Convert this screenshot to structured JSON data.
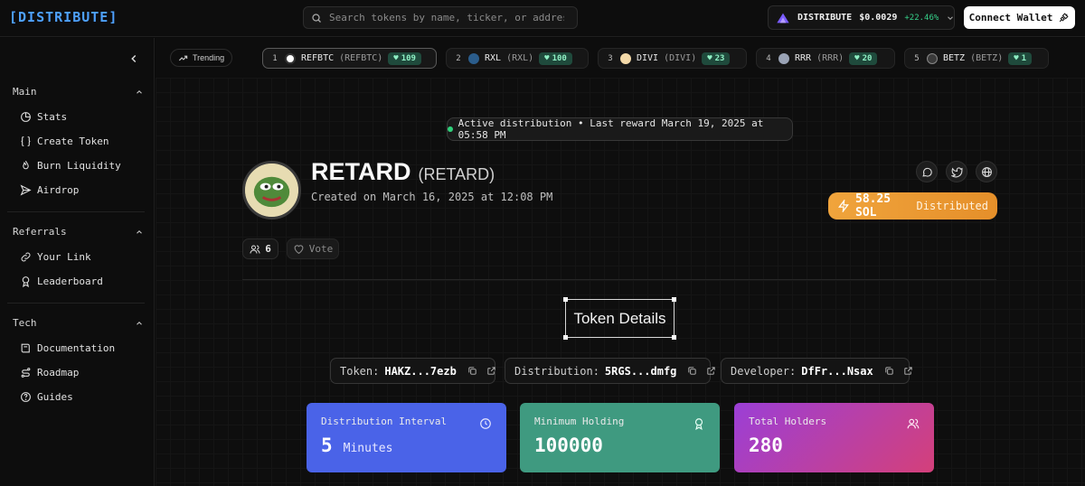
{
  "header": {
    "logo": "[DISTRIBUTE]",
    "search_placeholder": "Search tokens by name, ticker, or address...",
    "price_token": "DISTRIBUTE",
    "price_value": "$0.0029",
    "price_change": "+22.46%",
    "connect_label": "Connect Wallet"
  },
  "sidebar": {
    "sections": [
      {
        "title": "Main",
        "items": [
          {
            "label": "Stats",
            "icon": "chart-icon"
          },
          {
            "label": "Create Token",
            "icon": "braces-icon"
          },
          {
            "label": "Burn Liquidity",
            "icon": "flame-icon"
          },
          {
            "label": "Airdrop",
            "icon": "send-icon"
          }
        ]
      },
      {
        "title": "Referrals",
        "items": [
          {
            "label": "Your Link",
            "icon": "link-icon"
          },
          {
            "label": "Leaderboard",
            "icon": "award-icon"
          }
        ]
      },
      {
        "title": "Tech",
        "items": [
          {
            "label": "Documentation",
            "icon": "book-icon"
          },
          {
            "label": "Roadmap",
            "icon": "route-icon"
          },
          {
            "label": "Guides",
            "icon": "help-icon"
          }
        ]
      }
    ]
  },
  "trending": {
    "label": "Trending",
    "tokens": [
      {
        "rank": "1",
        "name": "REFBTC",
        "ticker": "(REFBTC)",
        "votes": "109"
      },
      {
        "rank": "2",
        "name": "RXL",
        "ticker": "(RXL)",
        "votes": "100"
      },
      {
        "rank": "3",
        "name": "DIVI",
        "ticker": "(DIVI)",
        "votes": "23"
      },
      {
        "rank": "4",
        "name": "RRR",
        "ticker": "(RRR)",
        "votes": "20"
      },
      {
        "rank": "5",
        "name": "BETZ",
        "ticker": "(BETZ)",
        "votes": "1"
      }
    ]
  },
  "token": {
    "status": "Active distribution • Last reward March 19, 2025 at 05:58 PM",
    "name": "RETARD",
    "ticker": "(RETARD)",
    "created": "Created on March 16, 2025 at 12:08 PM",
    "distributed_amount": "58.25 SOL",
    "distributed_label": "Distributed",
    "holders_count": "6",
    "vote_label": "Vote"
  },
  "details": {
    "heading": "Token Details",
    "addresses": [
      {
        "key": "Token:",
        "value": "HAKZ...7ezb"
      },
      {
        "key": "Distribution:",
        "value": "5RGS...dmfg"
      },
      {
        "key": "Developer:",
        "value": "DfFr...Nsax"
      }
    ],
    "cards": [
      {
        "label": "Distribution Interval",
        "value": "5",
        "unit": "Minutes"
      },
      {
        "label": "Minimum Holding",
        "value": "100000"
      },
      {
        "label": "Total Holders",
        "value": "280"
      }
    ]
  },
  "colors": {
    "accent_blue": "#4ea1ff",
    "positive": "#36d18a",
    "card1": "#4a63e8",
    "card2": "#3f9a80",
    "card3_from": "#9b3fd6",
    "card3_to": "#d4407a",
    "distributed": "#f0a43c"
  }
}
